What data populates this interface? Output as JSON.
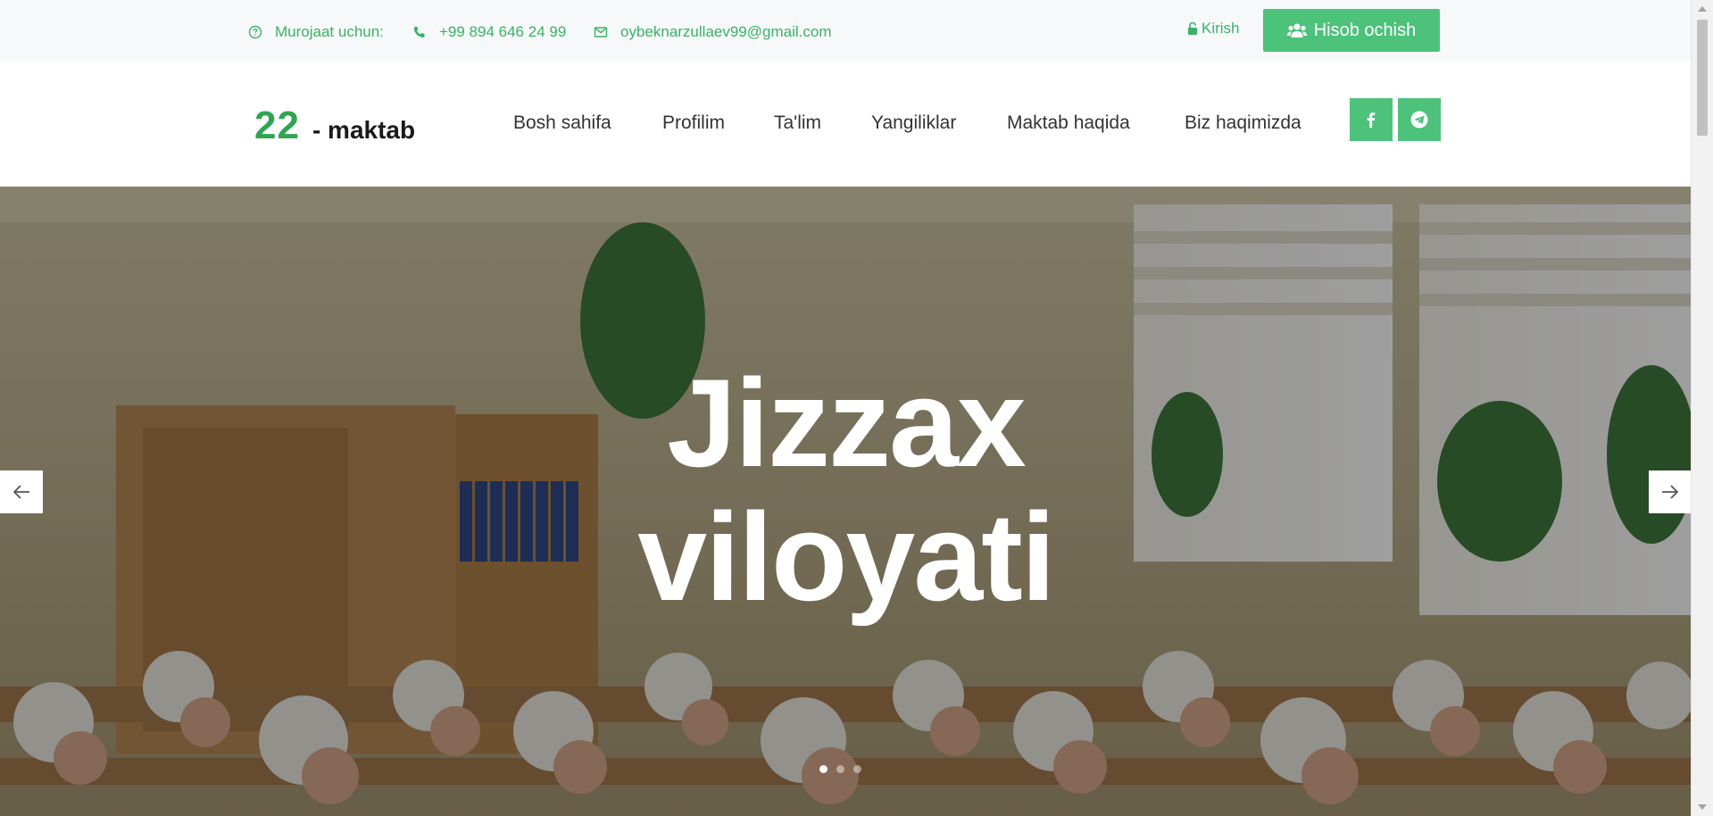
{
  "topbar": {
    "contact_label": "Murojaat uchun:",
    "phone": "+99 894 646 24 99",
    "email": "oybeknarzullaev99@gmail.com",
    "login_label": "Kirish",
    "signup_label": "Hisob ochish"
  },
  "logo": {
    "number": "22",
    "text": "- maktab"
  },
  "nav": {
    "items": [
      {
        "label": "Bosh sahifa"
      },
      {
        "label": "Profilim"
      },
      {
        "label": "Ta'lim"
      },
      {
        "label": "Yangiliklar"
      },
      {
        "label": "Maktab haqida"
      },
      {
        "label": "Biz haqimizda"
      }
    ]
  },
  "social": {
    "icons": [
      "facebook-icon",
      "telegram-icon"
    ]
  },
  "hero": {
    "title_line1": "Jizzax",
    "title_line2": "viloyati",
    "slide_count": 3,
    "active_slide": 1
  },
  "colors": {
    "accent": "#4cc27a",
    "accent_text": "#37b466",
    "logo_green": "#2fa552",
    "topbar_bg": "#f7f8f9"
  }
}
